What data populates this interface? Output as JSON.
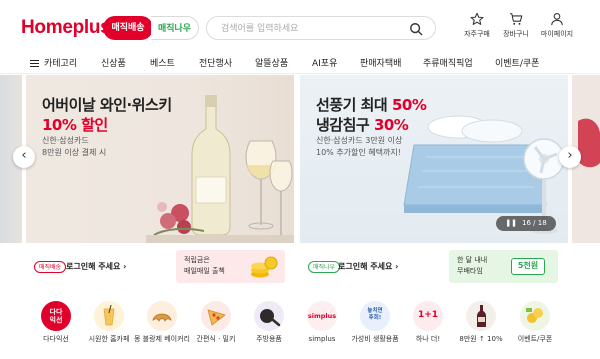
{
  "header": {
    "logo": "Homeplus",
    "tab_delivery": "매직배송",
    "tab_now": "매직나우",
    "search_placeholder": "검색어를 입력하세요",
    "icons": [
      {
        "name": "star-icon",
        "label": "자주구매"
      },
      {
        "name": "cart-icon",
        "label": "장바구니"
      },
      {
        "name": "user-icon",
        "label": "마이페이지"
      }
    ]
  },
  "nav": {
    "category": "카테고리",
    "items": [
      "신상품",
      "베스트",
      "전단행사",
      "알뜰상품",
      "AI포유",
      "판매자택배",
      "주류매직픽업",
      "이벤트/쿠폰"
    ]
  },
  "banner": {
    "left": {
      "title_line1": "어버이날 와인·위스키",
      "title_line2": "10% 할인",
      "sub_line1": "신한·삼성카드",
      "sub_line2": "8만원 이상 결제 시"
    },
    "right": {
      "title_line1_a": "선풍기 최대 ",
      "title_line1_b": "50%",
      "title_line2_a": "냉감침구 ",
      "title_line2_b": "30%",
      "sub_line1": "신한·삼성카드 3만원 이상",
      "sub_line2": "10% 추가할인 혜택까지!"
    },
    "counter": "16 / 18",
    "prev_icon": "‹",
    "next_icon": "›"
  },
  "strips": {
    "left_badge": "매직배송",
    "left_text": "로그인해 주세요 ›",
    "left_promo_line1": "적립금은",
    "left_promo_line2": "매일매일 출첵",
    "right_badge": "매직나우",
    "right_text": "로그인해 주세요 ›",
    "right_promo_line1": "한 달 내내",
    "right_promo_line2": "무배타임",
    "right_promo_value": "5천원"
  },
  "categories": [
    {
      "label": "다다익선",
      "icon": "dada-icon",
      "color": "#e0002a",
      "text": "다다\n익선"
    },
    {
      "label": "시원한 홈카페",
      "icon": "iced-drink-icon",
      "color": "#fff2d6"
    },
    {
      "label": "몽 블랑제 베이커리",
      "icon": "croissant-icon",
      "color": "#fdeede"
    },
    {
      "label": "간편식 · 밀키",
      "icon": "pizza-icon",
      "color": "#fde9e6"
    },
    {
      "label": "주방용품",
      "icon": "frying-pan-icon",
      "color": "#efeaf6"
    },
    {
      "label": "simplus",
      "icon": "simplus-icon",
      "color": "#fdeef0",
      "text": "simplus"
    },
    {
      "label": "가성비 생활용품",
      "icon": "value-icon",
      "color": "#e9f0fb",
      "text": "놓치면\n후회!"
    },
    {
      "label": "하나 더!",
      "icon": "one-plus-one-icon",
      "color": "#fdecee",
      "text": "1+1"
    },
    {
      "label": "8만원 ↑ 10%",
      "icon": "wine-bottle-icon",
      "color": "#f3efe9"
    },
    {
      "label": "이벤트/쿠폰",
      "icon": "coupon-icon",
      "color": "#eef5e3"
    }
  ]
}
